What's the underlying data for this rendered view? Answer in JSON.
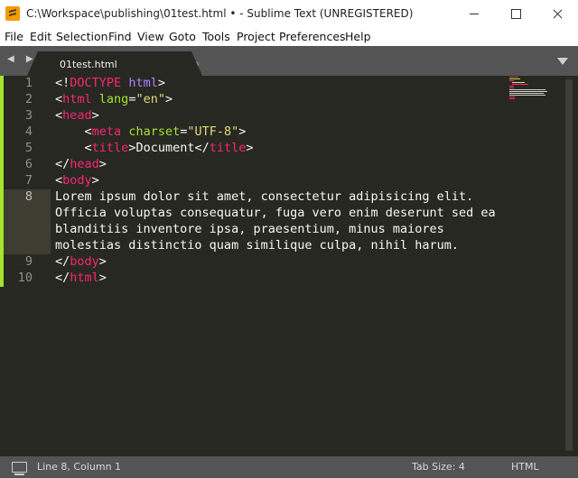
{
  "window": {
    "title": "C:\\Workspace\\publishing\\01test.html • - Sublime Text (UNREGISTERED)",
    "app_icon": "sublime-text-icon"
  },
  "menu": [
    "File",
    "Edit",
    "Selection",
    "Find",
    "View",
    "Goto",
    "Tools",
    "Project",
    "Preferences",
    "Help"
  ],
  "tabs": {
    "active": {
      "label": "01test.html",
      "modified": true
    },
    "nav_arrows": "◀ ▶"
  },
  "editor": {
    "current_line": 8,
    "line_numbers": [
      "1",
      "2",
      "3",
      "4",
      "5",
      "6",
      "7",
      "8",
      "9",
      "10"
    ],
    "lines": [
      "<!DOCTYPE html>",
      "<html lang=\"en\">",
      "<head>",
      "    <meta charset=\"UTF-8\">",
      "    <title>Document</title>",
      "</head>",
      "<body>",
      "Lorem ipsum dolor sit amet, consectetur adipisicing elit.",
      "Officia voluptas consequatur, fuga vero enim deserunt sed ea",
      "blanditiis inventore ipsa, praesentium, minus maiores",
      "molestias distinctio quam similique culpa, nihil harum.",
      "</body>",
      "</html>"
    ]
  },
  "status": {
    "position": "Line 8, Column 1",
    "tab_size": "Tab Size: 4",
    "syntax": "HTML"
  },
  "colors": {
    "background": "#272822",
    "tag": "#f92672",
    "attribute": "#a6e22e",
    "string": "#e6db74",
    "keyword": "#ae81ff",
    "text": "#f8f8f2",
    "gutter_modified": "#a6e22e"
  }
}
